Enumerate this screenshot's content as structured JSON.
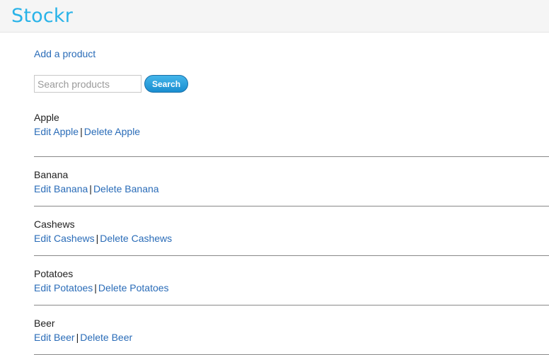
{
  "header": {
    "brand": "Stockr"
  },
  "actions": {
    "add_product": "Add a product"
  },
  "search": {
    "placeholder": "Search products",
    "value": "",
    "button_label": "Search"
  },
  "products": [
    {
      "name": "Apple",
      "edit_label": "Edit Apple",
      "delete_label": "Delete Apple"
    },
    {
      "name": "Banana",
      "edit_label": "Edit Banana",
      "delete_label": "Delete Banana"
    },
    {
      "name": "Cashews",
      "edit_label": "Edit Cashews",
      "delete_label": "Delete Cashews"
    },
    {
      "name": "Potatoes",
      "edit_label": "Edit Potatoes",
      "delete_label": "Delete Potatoes"
    },
    {
      "name": "Beer",
      "edit_label": "Edit Beer",
      "delete_label": "Delete Beer"
    }
  ],
  "separator": "|",
  "colors": {
    "brand": "#29b3e8",
    "link": "#2a6cb8",
    "button": "#1a8ed0"
  }
}
